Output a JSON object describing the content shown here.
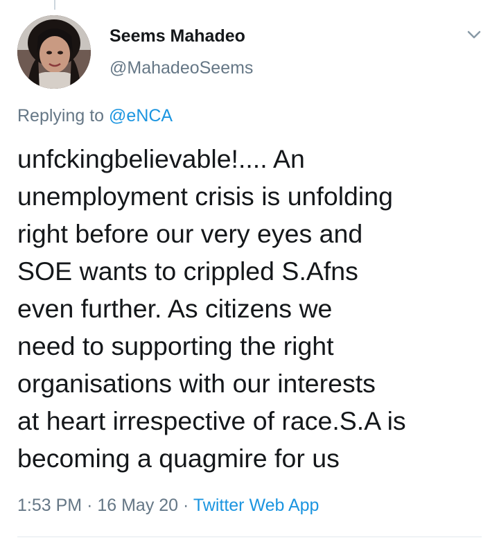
{
  "user": {
    "name": "Seems Mahadeo",
    "handle": "@MahadeoSeems"
  },
  "reply": {
    "prefix": "Replying to",
    "to": "@eNCA"
  },
  "tweet": {
    "lines": [
      "unfckingbelievable!.... An",
      "unemployment crisis is unfolding",
      "right before our very eyes and",
      "SOE wants to crippled S.Afns",
      "even further. As citizens we",
      "need to supporting the right",
      "organisations with our interests",
      "at heart irrespective of race.S.A is",
      "becoming a quagmire for us"
    ]
  },
  "meta": {
    "time": "1:53 PM",
    "sep1": "·",
    "date": "16 May 20",
    "sep2": "·",
    "source": "Twitter Web App"
  },
  "icons": {
    "menu": "chevron-down-icon",
    "avatar": "avatar"
  },
  "colors": {
    "text": "#14171a",
    "muted": "#657786",
    "link": "#1b95e0",
    "divider": "#e1e8ed"
  }
}
